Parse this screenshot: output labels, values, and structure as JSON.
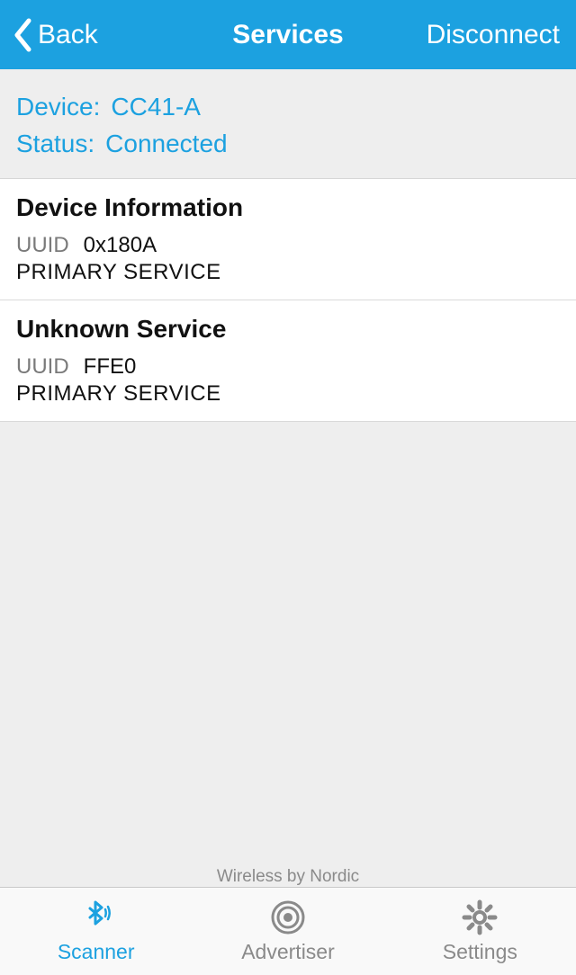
{
  "nav": {
    "back": "Back",
    "title": "Services",
    "action": "Disconnect"
  },
  "device": {
    "label": "Device:",
    "name": "CC41-A"
  },
  "status": {
    "label": "Status:",
    "value": "Connected"
  },
  "services": [
    {
      "title": "Device Information",
      "uuid_label": "UUID",
      "uuid": "0x180A",
      "type": "PRIMARY SERVICE"
    },
    {
      "title": "Unknown Service",
      "uuid_label": "UUID",
      "uuid": "FFE0",
      "type": "PRIMARY SERVICE"
    }
  ],
  "footer": "Wireless by Nordic",
  "tabs": {
    "scanner": "Scanner",
    "advertiser": "Advertiser",
    "settings": "Settings"
  }
}
